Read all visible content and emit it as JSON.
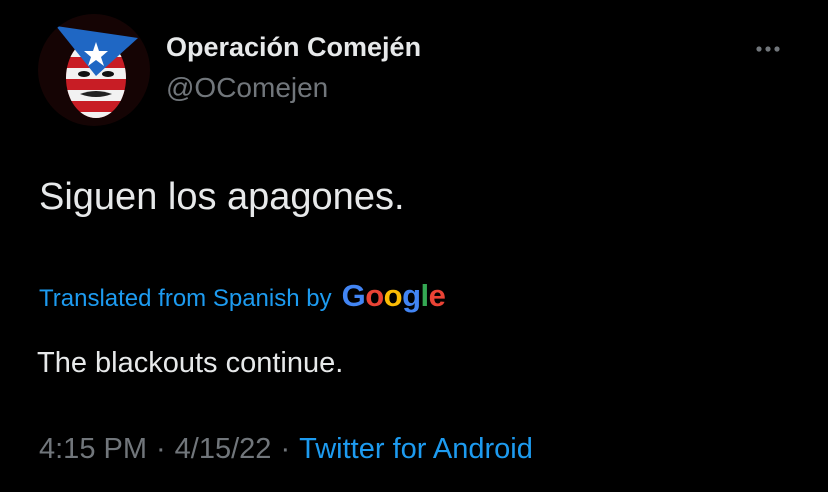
{
  "author": {
    "display_name": "Operación Comején",
    "handle": "@OComejen",
    "avatar_icon": "masked-face-flag-avatar"
  },
  "tweet": {
    "text": "Siguen los apagones.",
    "translated_label": "Translated from Spanish by",
    "translation_provider": {
      "letters": [
        "G",
        "o",
        "o",
        "g",
        "l",
        "e"
      ],
      "colors": [
        "#4285F4",
        "#EA4335",
        "#FBBC05",
        "#4285F4",
        "#34A853",
        "#EA4335"
      ]
    },
    "translation": "The blackouts continue."
  },
  "meta": {
    "time": "4:15 PM",
    "separator": "·",
    "date": "4/15/22",
    "source": "Twitter for Android"
  },
  "icons": {
    "more": "more-options-icon"
  },
  "colors": {
    "background": "#000000",
    "primary_text": "#e7e9ea",
    "secondary_text": "#71767b",
    "accent": "#1d9bf0"
  }
}
